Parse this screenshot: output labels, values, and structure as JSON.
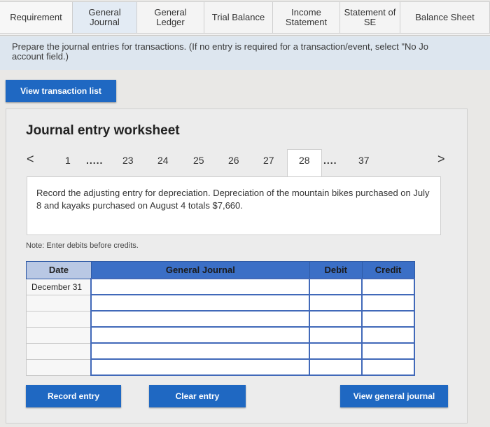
{
  "tabs": [
    {
      "label": "Requirement"
    },
    {
      "label": "General Journal"
    },
    {
      "label": "General Ledger"
    },
    {
      "label": "Trial Balance"
    },
    {
      "label": "Income Statement"
    },
    {
      "label": "Statement of SE"
    },
    {
      "label": "Balance Sheet"
    }
  ],
  "instructions": {
    "line1": "Prepare the journal entries for transactions. (If no entry is required for a transaction/event, select \"No Jo",
    "line2": "account field.)"
  },
  "buttons": {
    "view_transaction_list": "View transaction list",
    "record_entry": "Record entry",
    "clear_entry": "Clear entry",
    "view_general_journal": "View general journal"
  },
  "worksheet": {
    "title": "Journal entry worksheet",
    "pager": {
      "prev": "<",
      "next": ">",
      "ellipsis": ".....",
      "ellipsis2": "....",
      "pages": [
        "1",
        "23",
        "24",
        "25",
        "26",
        "27",
        "28",
        "37"
      ],
      "active": "28"
    },
    "prompt": "Record the adjusting entry for depreciation. Depreciation of the mountain bikes purchased on July 8 and kayaks purchased on August 4 totals $7,660.",
    "note": "Note: Enter debits before credits."
  },
  "journal_table": {
    "headers": {
      "date": "Date",
      "account": "General Journal",
      "debit": "Debit",
      "credit": "Credit"
    },
    "rows": [
      {
        "date": "December 31",
        "account": "",
        "debit": "",
        "credit": ""
      },
      {
        "date": "",
        "account": "",
        "debit": "",
        "credit": ""
      },
      {
        "date": "",
        "account": "",
        "debit": "",
        "credit": ""
      },
      {
        "date": "",
        "account": "",
        "debit": "",
        "credit": ""
      },
      {
        "date": "",
        "account": "",
        "debit": "",
        "credit": ""
      },
      {
        "date": "",
        "account": "",
        "debit": "",
        "credit": ""
      }
    ]
  },
  "colors": {
    "accent_button": "#1f68c2",
    "table_header": "#3b6fc6",
    "instruction_band": "#dde6ef"
  }
}
